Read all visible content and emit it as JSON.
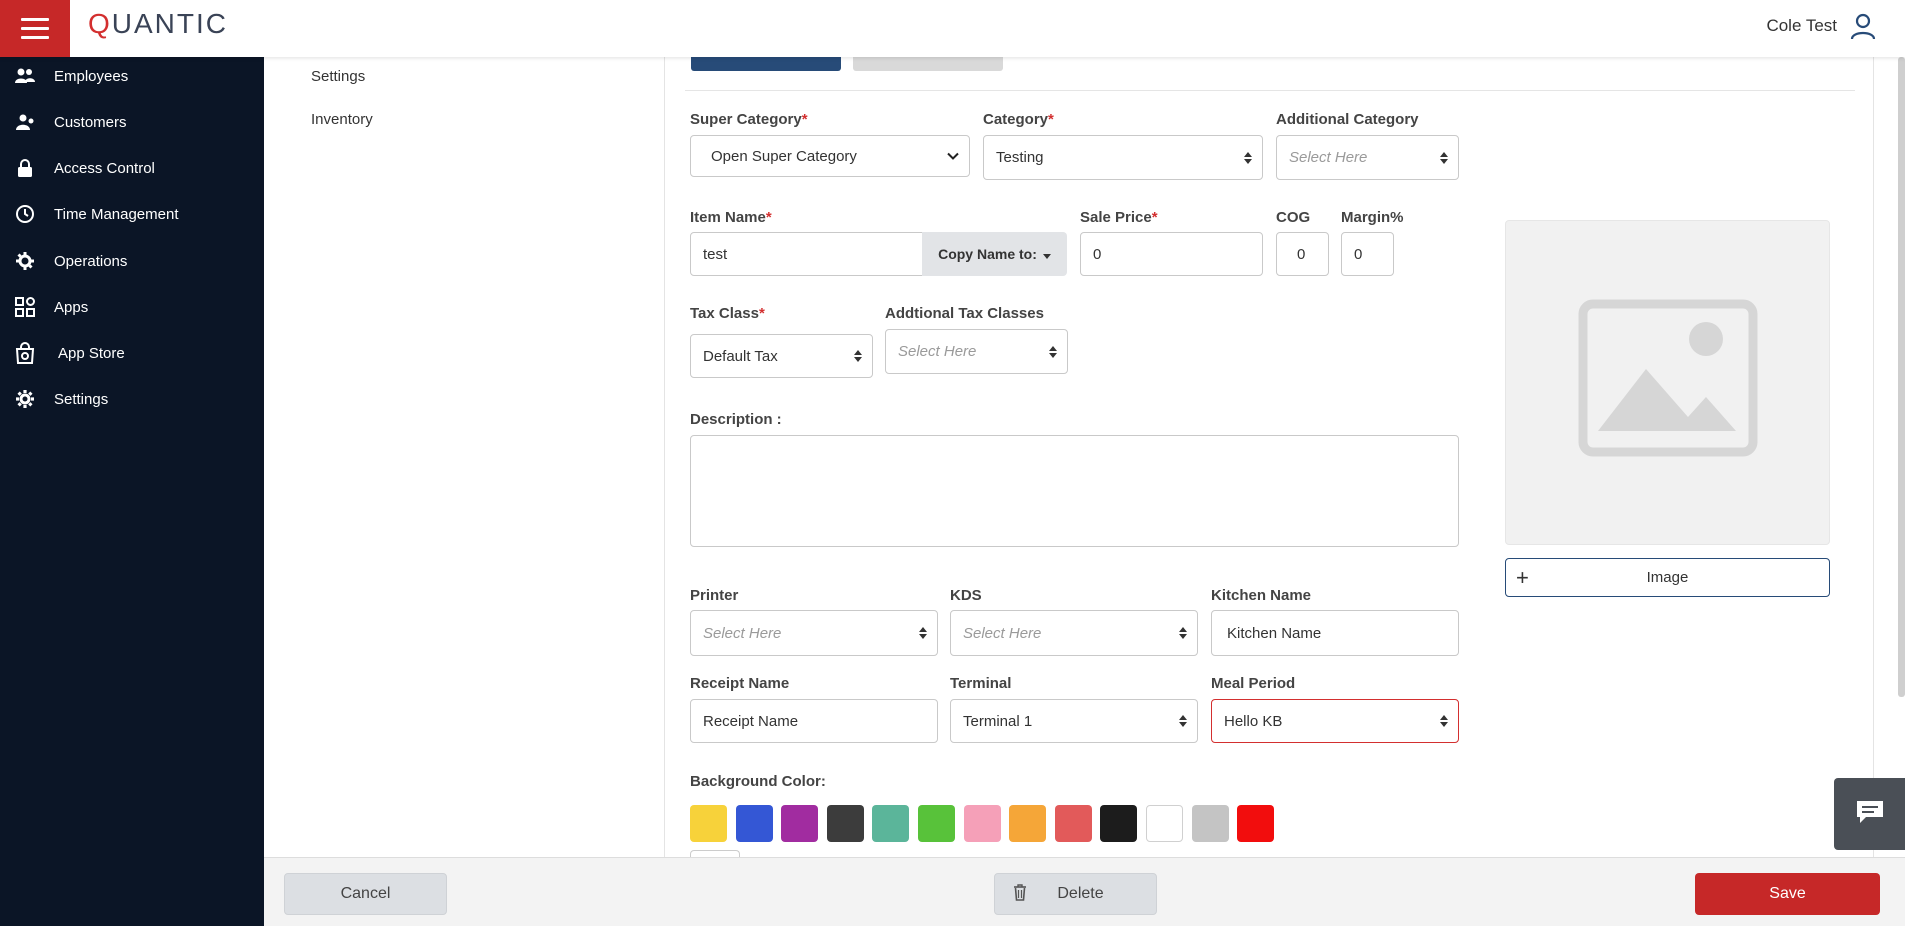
{
  "header": {
    "brand_prefix": "Q",
    "brand_rest": "UANTIC",
    "user_name": "Cole Test"
  },
  "sidebar": {
    "items": [
      {
        "label": "Employees",
        "icon": "users-icon"
      },
      {
        "label": "Customers",
        "icon": "customers-icon"
      },
      {
        "label": "Access Control",
        "icon": "lock-icon"
      },
      {
        "label": "Time Management",
        "icon": "clock-icon"
      },
      {
        "label": "Operations",
        "icon": "operations-gear-icon"
      },
      {
        "label": "Apps",
        "icon": "apps-grid-icon"
      },
      {
        "label": "App Store",
        "icon": "app-store-bag-icon"
      },
      {
        "label": "Settings",
        "icon": "gear-icon"
      }
    ]
  },
  "subnav": {
    "items": [
      "Settings",
      "Inventory"
    ]
  },
  "form": {
    "super_category": {
      "label": "Super Category",
      "value": "Open Super Category"
    },
    "category": {
      "label": "Category",
      "value": "Testing"
    },
    "additional_category": {
      "label": "Additional Category",
      "placeholder": "Select Here"
    },
    "item_name": {
      "label": "Item Name",
      "value": "test",
      "copy_label": "Copy Name to:"
    },
    "sale_price": {
      "label": "Sale Price",
      "value": "0"
    },
    "cog": {
      "label": "COG",
      "value": "0"
    },
    "margin": {
      "label": "Margin%",
      "value": "0"
    },
    "tax_class": {
      "label": "Tax Class",
      "value": "Default Tax"
    },
    "additional_tax": {
      "label": "Addtional Tax Classes",
      "placeholder": "Select Here"
    },
    "description": {
      "label": "Description :"
    },
    "printer": {
      "label": "Printer",
      "placeholder": "Select Here"
    },
    "kds": {
      "label": "KDS",
      "placeholder": "Select Here"
    },
    "kitchen_name": {
      "label": "Kitchen Name",
      "value": "Kitchen Name"
    },
    "receipt_name": {
      "label": "Receipt Name",
      "value": "Receipt Name"
    },
    "terminal": {
      "label": "Terminal",
      "value": "Terminal 1"
    },
    "meal_period": {
      "label": "Meal Period",
      "value": "Hello KB"
    },
    "background_color": {
      "label": "Background Color:",
      "colors": [
        "#f7d23a",
        "#3457d5",
        "#a12ca0",
        "#3c3c3c",
        "#5bb59a",
        "#58c23a",
        "#f5a0b8",
        "#f5a638",
        "#e25a5a",
        "#1c1c1c",
        "#ffffff",
        "#c4c4c4",
        "#f20d0d"
      ]
    },
    "image_button": "Image"
  },
  "footer": {
    "cancel": "Cancel",
    "delete": "Delete",
    "save": "Save"
  }
}
